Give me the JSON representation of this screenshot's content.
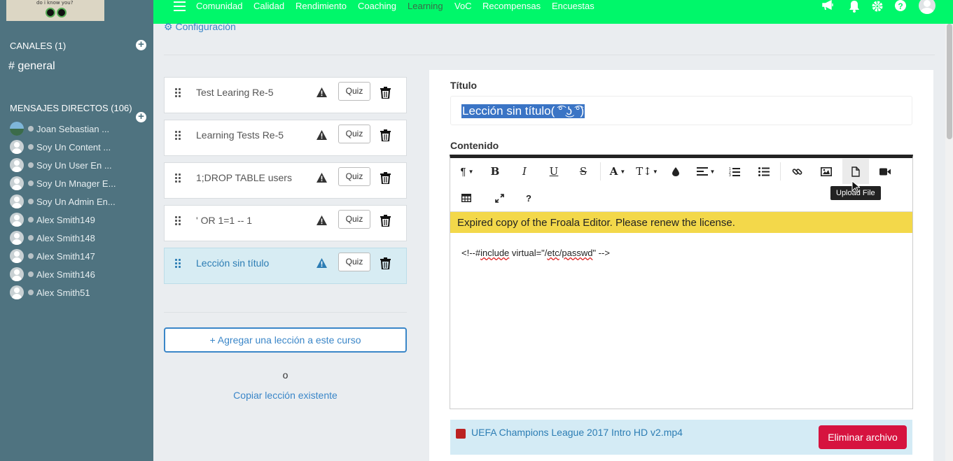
{
  "sidebar": {
    "channels_header": "CANALES (1)",
    "channels": [
      "# general"
    ],
    "dm_header": "MENSAJES DIRECTOS (106)",
    "dms": [
      "Joan Sebastian ...",
      "Soy Un Content ...",
      "Soy Un User En ...",
      "Soy Un Mnager E...",
      "Soy Un Admin En...",
      "Alex Smith149",
      "Alex Smith148",
      "Alex Smith147",
      "Alex Smith146",
      "Alex Smith51"
    ],
    "logo_text": "do i know you?"
  },
  "topnav": {
    "items": [
      "Comunidad",
      "Calidad",
      "Rendimiento",
      "Coaching",
      "Learning",
      "VoC",
      "Recompensas",
      "Encuestas"
    ],
    "active": "Learning"
  },
  "main": {
    "config_link": "Configuración",
    "lessons": [
      {
        "title": "Test Learing Re-5",
        "quiz": "Quiz"
      },
      {
        "title": "Learning Tests Re-5",
        "quiz": "Quiz"
      },
      {
        "title": "1;DROP TABLE users",
        "quiz": "Quiz"
      },
      {
        "title": "' OR 1=1 -- 1",
        "quiz": "Quiz"
      },
      {
        "title": "Lección sin título",
        "quiz": "Quiz",
        "selected": true
      }
    ],
    "add_lesson": "+ Agregar una lección a este curso",
    "or_text": "o",
    "copy_lesson": "Copiar lección existente"
  },
  "editor": {
    "title_label": "Título",
    "title_value": "Lección sin título( ͡° ͜ʖ ͡°)",
    "content_label": "Contenido",
    "tooltip": "Upload File",
    "license_banner": "Expired copy of the Froala Editor. Please renew the license.",
    "content_before": "<!--#",
    "content_sq1": "include",
    "content_mid": " virtual=\"/",
    "content_sq2": "etc",
    "content_mid2": "/",
    "content_sq3": "passwd",
    "content_after": "\" -->",
    "attachment": {
      "name": "UEFA Champions League 2017 Intro HD v2.mp4",
      "delete_label": "Eliminar archivo"
    }
  },
  "colors": {
    "topbar": "#00f76a",
    "sidebar": "#4f7380",
    "accent": "#3a86c8",
    "danger": "#d6133f",
    "banner": "#f3d84a"
  }
}
